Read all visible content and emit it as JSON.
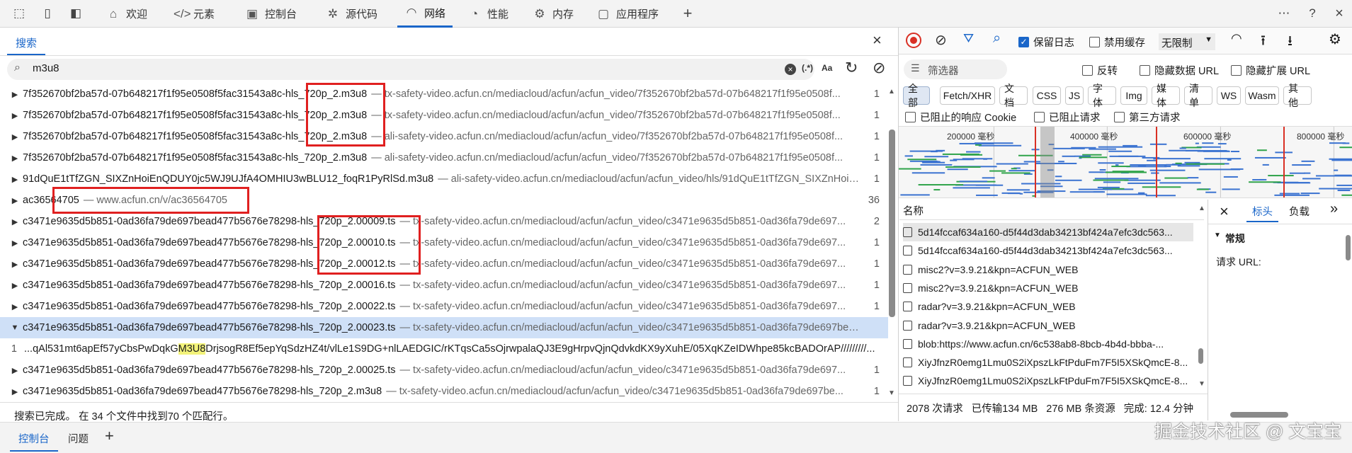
{
  "toolbar": {
    "tabs": [
      {
        "label": "欢迎",
        "icon": "home-icon"
      },
      {
        "label": "元素",
        "icon": "code-icon"
      },
      {
        "label": "控制台",
        "icon": "console-icon"
      },
      {
        "label": "源代码",
        "icon": "bug-icon"
      },
      {
        "label": "网络",
        "icon": "wifi-icon"
      },
      {
        "label": "性能",
        "icon": "gauge-icon"
      },
      {
        "label": "内存",
        "icon": "gear-icon"
      },
      {
        "label": "应用程序",
        "icon": "app-icon"
      }
    ],
    "active_tab": "网络"
  },
  "search": {
    "tab_label": "搜索",
    "query": "m3u8",
    "regex_label": "(.*)",
    "case_label": "Aa",
    "status": "搜索已完成。 在 34 个文件中找到70 个匹配行。",
    "results": [
      {
        "file": "7f352670bf2ba57d-07b648217f1f95e0508f5fac31543a8c-hls_720p_2.m3u8",
        "url": "— tx-safety-video.acfun.cn/mediacloud/acfun/acfun_video/7f352670bf2ba57d-07b648217f1f95e0508f...",
        "count": "1"
      },
      {
        "file": "7f352670bf2ba57d-07b648217f1f95e0508f5fac31543a8c-hls_720p_2.m3u8",
        "url": "— tx-safety-video.acfun.cn/mediacloud/acfun/acfun_video/7f352670bf2ba57d-07b648217f1f95e0508f...",
        "count": "1"
      },
      {
        "file": "7f352670bf2ba57d-07b648217f1f95e0508f5fac31543a8c-hls_720p_2.m3u8",
        "url": "— ali-safety-video.acfun.cn/mediacloud/acfun/acfun_video/7f352670bf2ba57d-07b648217f1f95e0508f...",
        "count": "1"
      },
      {
        "file": "7f352670bf2ba57d-07b648217f1f95e0508f5fac31543a8c-hls_720p_2.m3u8",
        "url": "— ali-safety-video.acfun.cn/mediacloud/acfun/acfun_video/7f352670bf2ba57d-07b648217f1f95e0508f...",
        "count": "1"
      },
      {
        "file": "91dQuE1tTfZGN_SIXZnHoiEnQDUY0jc5WJ9UJfA4OMHIU3wBLU12_foqR1PyRlSd.m3u8",
        "url": "— ali-safety-video.acfun.cn/mediacloud/acfun/acfun_video/hls/91dQuE1tTfZGN_SIXZnHoiE...",
        "count": "1"
      },
      {
        "file": "ac36564705",
        "url": "— www.acfun.cn/v/ac36564705",
        "count": "36"
      },
      {
        "file": "c3471e9635d5b851-0ad36fa79de697bead477b5676e78298-hls_720p_2.00009.ts",
        "url": "— tx-safety-video.acfun.cn/mediacloud/acfun/acfun_video/c3471e9635d5b851-0ad36fa79de697...",
        "count": "2"
      },
      {
        "file": "c3471e9635d5b851-0ad36fa79de697bead477b5676e78298-hls_720p_2.00010.ts",
        "url": "— tx-safety-video.acfun.cn/mediacloud/acfun/acfun_video/c3471e9635d5b851-0ad36fa79de697...",
        "count": "1"
      },
      {
        "file": "c3471e9635d5b851-0ad36fa79de697bead477b5676e78298-hls_720p_2.00012.ts",
        "url": "— tx-safety-video.acfun.cn/mediacloud/acfun/acfun_video/c3471e9635d5b851-0ad36fa79de697...",
        "count": "1"
      },
      {
        "file": "c3471e9635d5b851-0ad36fa79de697bead477b5676e78298-hls_720p_2.00016.ts",
        "url": "— tx-safety-video.acfun.cn/mediacloud/acfun/acfun_video/c3471e9635d5b851-0ad36fa79de697...",
        "count": "1"
      },
      {
        "file": "c3471e9635d5b851-0ad36fa79de697bead477b5676e78298-hls_720p_2.00022.ts",
        "url": "— tx-safety-video.acfun.cn/mediacloud/acfun/acfun_video/c3471e9635d5b851-0ad36fa79de697...",
        "count": "1"
      },
      {
        "file": "c3471e9635d5b851-0ad36fa79de697bead477b5676e78298-hls_720p_2.00023.ts",
        "url": "— tx-safety-video.acfun.cn/mediacloud/acfun/acfun_video/c3471e9635d5b851-0ad36fa79de697bea...",
        "count": ""
      },
      {
        "file": "c3471e9635d5b851-0ad36fa79de697bead477b5676e78298-hls_720p_2.00025.ts",
        "url": "— tx-safety-video.acfun.cn/mediacloud/acfun/acfun_video/c3471e9635d5b851-0ad36fa79de697...",
        "count": "1"
      },
      {
        "file": "c3471e9635d5b851-0ad36fa79de697bead477b5676e78298-hls_720p_2.m3u8",
        "url": "— tx-safety-video.acfun.cn/mediacloud/acfun/acfun_video/c3471e9635d5b851-0ad36fa79de697be...",
        "count": "1"
      }
    ],
    "match": {
      "line": "1",
      "before": "...qAl531mt6apEf57yCbsPwDqkG",
      "hit": "M3U8",
      "after": "DrjsogR8Ef5epYqSdzHZ4t/vlLe1S9DG+nlLAEDGIC/rKTqsCa5sOjrwpalaQJ3E9gHrpvQjnQdvkdKX9yXuhE/05XqKZeIDWhpe85kcBADOrAP/////////..."
    }
  },
  "network": {
    "preserve_log": "保留日志",
    "disable_cache": "禁用缓存",
    "throttle": "无限制",
    "filter_placeholder": "筛选器",
    "invert": "反转",
    "hide_data_url": "隐藏数据 URL",
    "hide_ext_url": "隐藏扩展 URL",
    "types": [
      "全部",
      "Fetch/XHR",
      "文档",
      "CSS",
      "JS",
      "字体",
      "Img",
      "媒体",
      "清单",
      "WS",
      "Wasm",
      "其他"
    ],
    "blocked_cookie": "已阻止的响应 Cookie",
    "blocked_req": "已阻止请求",
    "third_party": "第三方请求",
    "timeline_ticks": [
      "200000 毫秒",
      "400000 毫秒",
      "600000 毫秒",
      "800000 毫秒"
    ],
    "name_header": "名称",
    "requests": [
      "5d14fccaf634a160-d5f44d3dab34213bf424a7efc3dc563...",
      "5d14fccaf634a160-d5f44d3dab34213bf424a7efc3dc563...",
      "misc2?v=3.9.21&kpn=ACFUN_WEB",
      "misc2?v=3.9.21&kpn=ACFUN_WEB",
      "radar?v=3.9.21&kpn=ACFUN_WEB",
      "radar?v=3.9.21&kpn=ACFUN_WEB",
      "blob:https://www.acfun.cn/6c538ab8-8bcb-4b4d-bbba-...",
      "XiyJfnzR0emg1Lmu0S2iXpszLkFtPduFm7F5I5XSkQmcE-8...",
      "XiyJfnzR0emg1Lmu0S2iXpszLkFtPduFm7F5I5XSkQmcE-8..."
    ],
    "summary": {
      "requests": "2078 次请求",
      "transferred": "已传输134 MB",
      "resources": "276 MB 条资源",
      "finish": "完成: 12.4 分钟"
    },
    "detail_tabs": [
      "标头",
      "负载"
    ],
    "general_label": "常规",
    "request_url_label": "请求 URL:"
  },
  "drawer": {
    "tabs": [
      "控制台",
      "问题"
    ]
  },
  "watermark": "掘金技术社区 @ 文宝宝"
}
